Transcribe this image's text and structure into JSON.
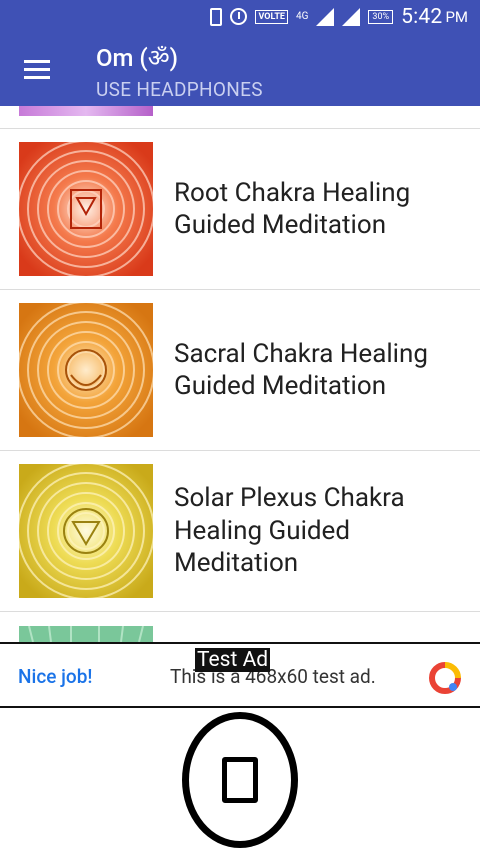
{
  "status_bar": {
    "volte": "VOLTE",
    "network": "4G",
    "battery": "30%",
    "time": "5:42",
    "ampm": "PM"
  },
  "app_bar": {
    "title": "Om (ॐ)",
    "subtitle": "USE HEADPHONES"
  },
  "list": {
    "items": [
      {
        "title": "Root Chakra Healing Guided Meditation",
        "thumb_color": "#e8522e"
      },
      {
        "title": "Sacral Chakra Healing Guided Meditation",
        "thumb_color": "#e8901f"
      },
      {
        "title": "Solar Plexus Chakra Healing Guided Meditation",
        "thumb_color": "#e0c52a"
      }
    ]
  },
  "ad": {
    "label": "Test Ad",
    "nice": "Nice job!",
    "text": "This is a 468x60 test ad."
  },
  "colors": {
    "primary": "#3f51b5",
    "subtitle": "#c9cff0",
    "ad_link": "#1a73e8"
  }
}
